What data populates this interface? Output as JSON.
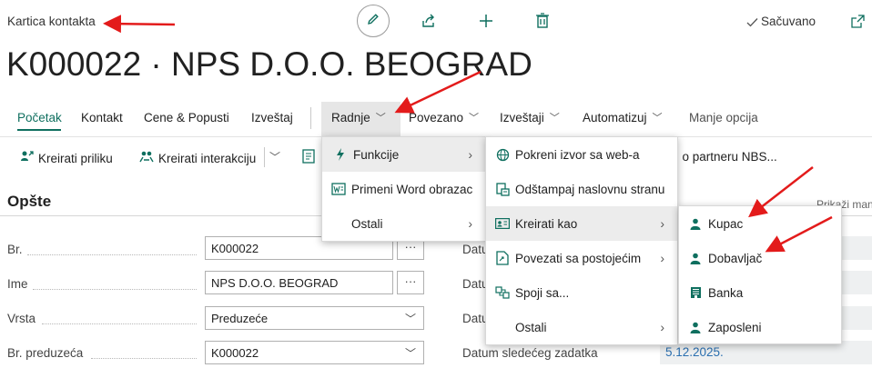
{
  "header": {
    "breadcrumb": "Kartica kontakta",
    "saved_label": "Sačuvano",
    "title": "K000022 · NPS D.O.O. BEOGRAD"
  },
  "tabs": [
    {
      "label": "Početak"
    },
    {
      "label": "Kontakt"
    },
    {
      "label": "Cene & Popusti"
    },
    {
      "label": "Izveštaj"
    },
    {
      "label": "Radnje"
    },
    {
      "label": "Povezano"
    },
    {
      "label": "Izveštaji"
    },
    {
      "label": "Automatizuj"
    },
    {
      "label": "Manje opcija"
    }
  ],
  "actions": {
    "create_opportunity": "Kreirati priliku",
    "create_interaction": "Kreirati interakciju",
    "nbs_partial": "ci o partneru NBS..."
  },
  "section": {
    "title": "Opšte",
    "show_more": "Prikaži manje"
  },
  "fields": [
    {
      "label": "Br.",
      "value": "K000022"
    },
    {
      "label": "Ime",
      "value": "NPS D.O.O. BEOGRAD"
    },
    {
      "label": "Vrsta",
      "value": "Preduzeće"
    },
    {
      "label": "Br. preduzeća",
      "value": "K000022"
    }
  ],
  "right_fields": [
    {
      "label": "Datu"
    },
    {
      "label": "Datu"
    },
    {
      "label": "Datu"
    },
    {
      "label": "Datum sledećeg zadatka",
      "value": "5.12.2025."
    }
  ],
  "menu1": [
    {
      "label": "Funkcije"
    },
    {
      "label": "Primeni Word obrazac"
    },
    {
      "label": "Ostali"
    }
  ],
  "menu2": [
    {
      "label": "Pokreni izvor sa web-a"
    },
    {
      "label": "Odštampaj naslovnu stranu"
    },
    {
      "label": "Kreirati kao"
    },
    {
      "label": "Povezati sa postojećim"
    },
    {
      "label": "Spoji sa..."
    },
    {
      "label": "Ostali"
    }
  ],
  "menu3": [
    {
      "label": "Kupac"
    },
    {
      "label": "Dobavljač"
    },
    {
      "label": "Banka"
    },
    {
      "label": "Zaposleni"
    }
  ],
  "colors": {
    "accent": "#0f6f5f",
    "link_blue": "#2a6fb0",
    "arrow_red": "#e31b1b"
  }
}
